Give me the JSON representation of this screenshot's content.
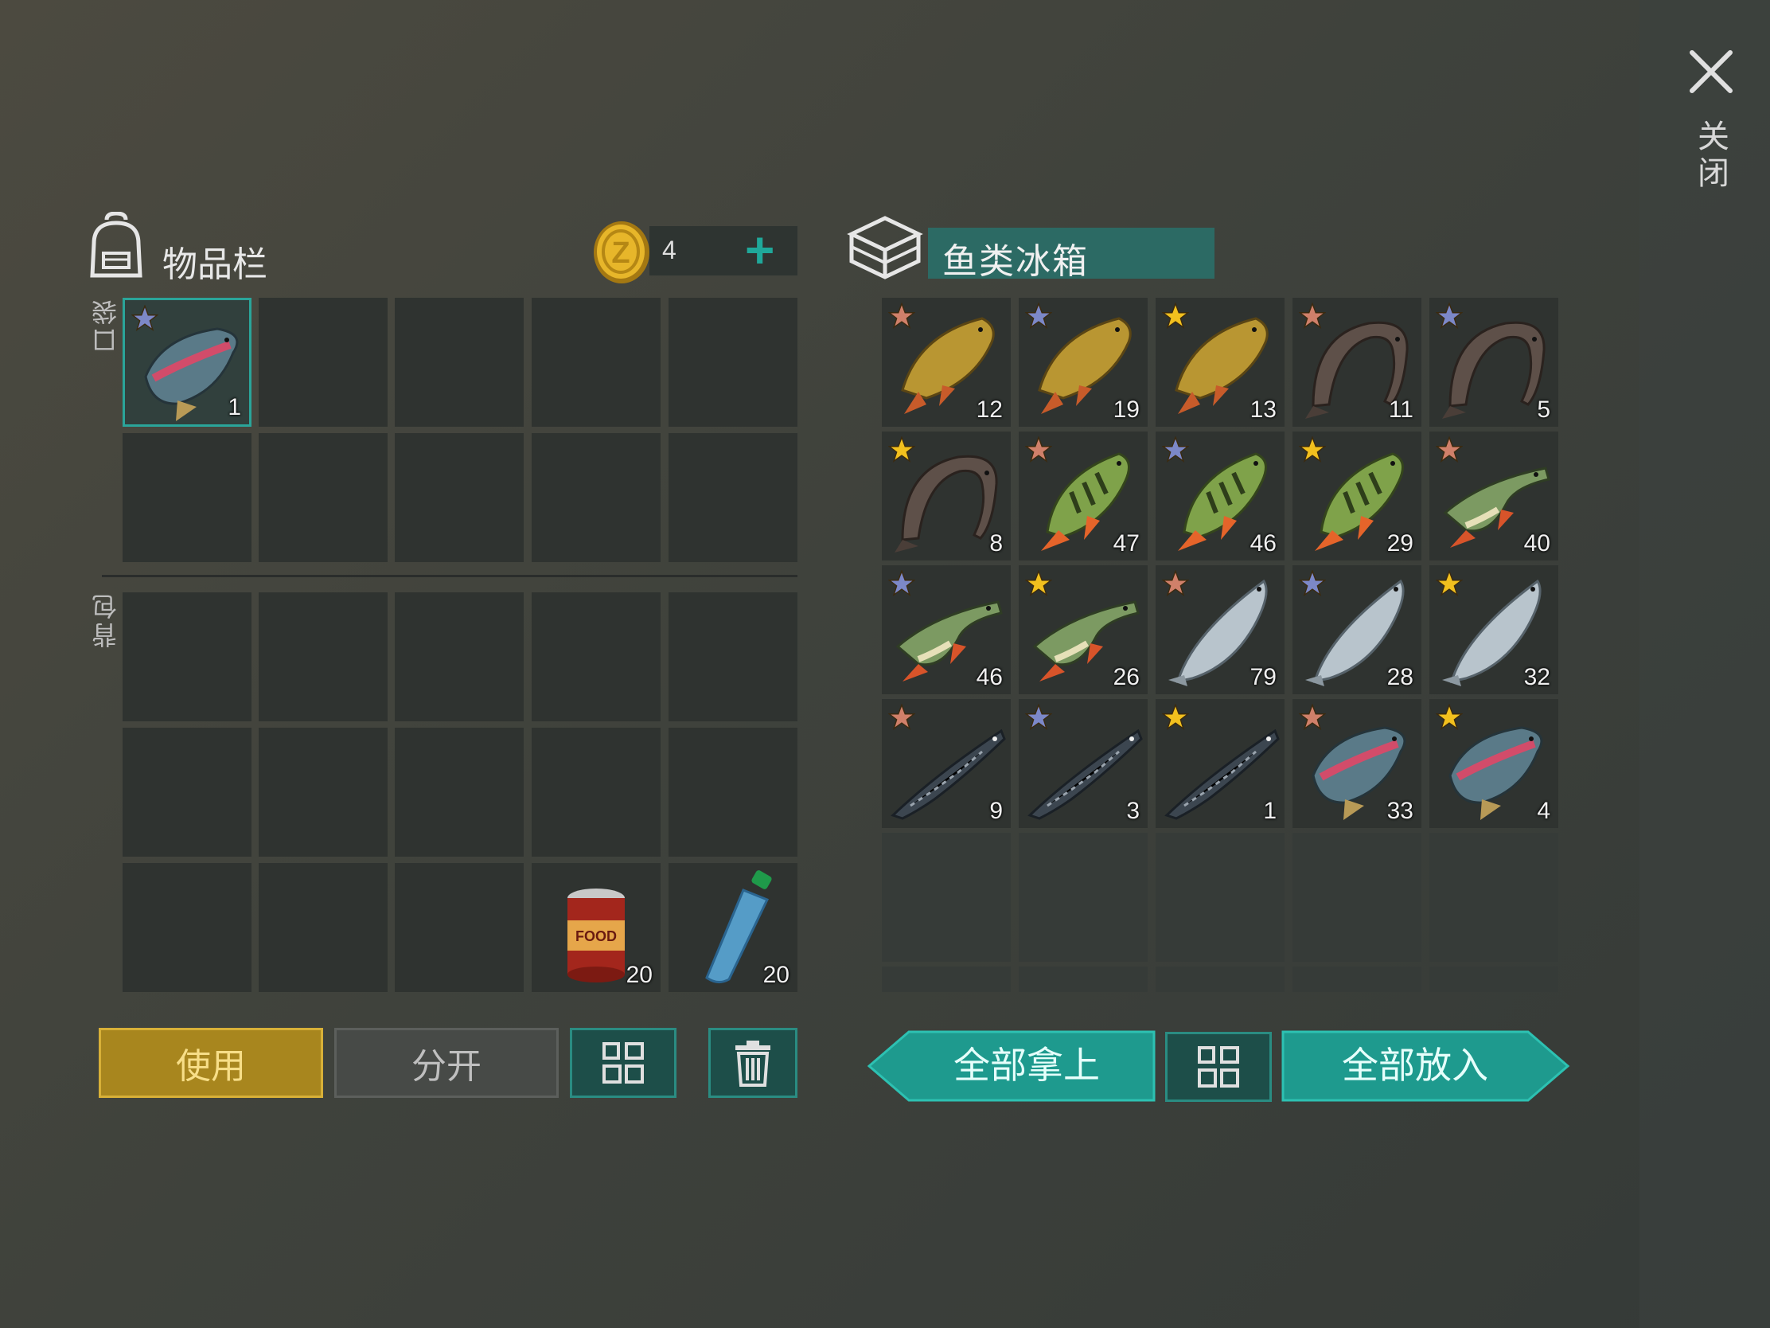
{
  "inventory": {
    "title": "物品栏",
    "coin_count": "4",
    "pocket_label": "口袋",
    "backpack_label": "背包",
    "pocket_slots": [
      {
        "item": "trout-icon",
        "qty": "1",
        "star": "blue"
      },
      null,
      null,
      null,
      null,
      null,
      null,
      null,
      null,
      null
    ],
    "backpack_slots": [
      null,
      null,
      null,
      null,
      null,
      null,
      null,
      null,
      null,
      null,
      null,
      null,
      null,
      {
        "item": "canned-food-icon",
        "qty": "20"
      },
      {
        "item": "water-bottle-icon",
        "qty": "20"
      }
    ],
    "buttons": {
      "use": "使用",
      "split": "分开"
    }
  },
  "cooler": {
    "title": "鱼类冰箱",
    "slots": [
      {
        "item": "carp-icon",
        "qty": "12",
        "star": "bronze"
      },
      {
        "item": "carp-icon",
        "qty": "19",
        "star": "blue"
      },
      {
        "item": "carp-icon",
        "qty": "13",
        "star": "gold"
      },
      {
        "item": "catfish-icon",
        "qty": "11",
        "star": "bronze"
      },
      {
        "item": "catfish-icon",
        "qty": "5",
        "star": "blue"
      },
      {
        "item": "catfish-icon",
        "qty": "8",
        "star": "gold"
      },
      {
        "item": "perch-icon",
        "qty": "47",
        "star": "bronze"
      },
      {
        "item": "perch-icon",
        "qty": "46",
        "star": "blue"
      },
      {
        "item": "perch-icon",
        "qty": "29",
        "star": "gold"
      },
      {
        "item": "pike-icon",
        "qty": "40",
        "star": "bronze"
      },
      {
        "item": "pike-icon",
        "qty": "46",
        "star": "blue"
      },
      {
        "item": "pike-icon",
        "qty": "26",
        "star": "gold"
      },
      {
        "item": "salmon-icon",
        "qty": "79",
        "star": "bronze"
      },
      {
        "item": "salmon-icon",
        "qty": "28",
        "star": "blue"
      },
      {
        "item": "salmon-icon",
        "qty": "32",
        "star": "gold"
      },
      {
        "item": "sturgeon-icon",
        "qty": "9",
        "star": "bronze"
      },
      {
        "item": "sturgeon-icon",
        "qty": "3",
        "star": "blue"
      },
      {
        "item": "sturgeon-icon",
        "qty": "1",
        "star": "gold"
      },
      {
        "item": "trout-icon",
        "qty": "33",
        "star": "bronze"
      },
      {
        "item": "trout-icon",
        "qty": "4",
        "star": "gold"
      }
    ],
    "buttons": {
      "take_all": "全部拿上",
      "put_all": "全部放入"
    }
  },
  "close_label": "关闭",
  "colors": {
    "accent": "#2aa59a",
    "gold_button": "#a8861e",
    "star_gold": "#f2c01e",
    "star_blue": "#7c88c8",
    "star_bronze": "#d0806a"
  }
}
